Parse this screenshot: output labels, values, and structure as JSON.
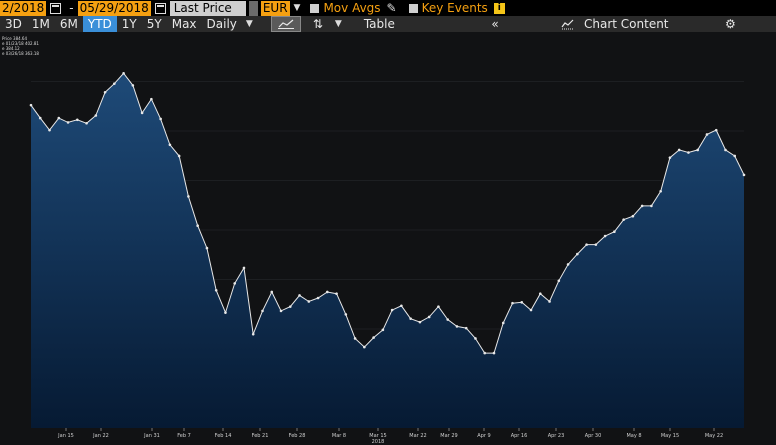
{
  "toolbar": {
    "start_date": "2/2018",
    "date_separator": "-",
    "end_date": "05/29/2018",
    "field": "Last Price",
    "currency": "EUR",
    "mov_avgs_label": "Mov Avgs",
    "key_events_label": "Key Events",
    "info_badge": "i"
  },
  "periods": [
    "3D",
    "1M",
    "6M",
    "YTD",
    "1Y",
    "5Y",
    "Max"
  ],
  "active_period": "YTD",
  "frequency": "Daily",
  "table_label": "Table",
  "back_label": "«",
  "chart_content_label": "Chart Content",
  "icons": {
    "calendar": "calendar-icon",
    "pencil": "pencil-icon",
    "gear": "gear-icon",
    "line_chart": "line-chart-icon",
    "chart_content": "chart-content-icon"
  },
  "colors": {
    "accent_orange": "#f5a011",
    "active_blue": "#3a8fd9",
    "series_line": "#e8e8e8",
    "area_fill_top": "#1e4a78",
    "area_fill_bottom": "#061a33"
  },
  "legend": {
    "line1": "Price   384.64",
    "line2": "e 01/23/18  402.81",
    "line3": "e           384.12",
    "line4": "e 03/26/18  363.18"
  },
  "chart_data": {
    "type": "area",
    "title": "",
    "xlabel": "",
    "ylabel": "",
    "x_tick_labels": [
      "Jan 15",
      "Jan 22",
      "Jan 31",
      "Feb 7",
      "Feb 14",
      "Feb 21",
      "Feb 28",
      "Mar 8",
      "Mar 15",
      "Mar 22",
      "Mar 29",
      "Apr 9",
      "Apr 16",
      "Apr 23",
      "Apr 30",
      "May 8",
      "May 15",
      "May 22"
    ],
    "x_year_label": "2018",
    "grid": true,
    "ylim": [
      359,
      405
    ],
    "series": [
      {
        "values": [
          396.5,
          395.0,
          393.6,
          395.0,
          394.5,
          394.8,
          394.4,
          395.3,
          398.0,
          399.0,
          400.2,
          398.8,
          395.6,
          397.2,
          394.9,
          391.9,
          390.6,
          385.9,
          382.5,
          379.9,
          375.0,
          372.4,
          375.8,
          377.6,
          369.9,
          372.6,
          374.8,
          372.6,
          373.1,
          374.4,
          373.7,
          374.1,
          374.8,
          374.6,
          372.2,
          369.4,
          368.4,
          369.5,
          370.4,
          372.7,
          373.2,
          371.7,
          371.3,
          371.9,
          373.1,
          371.6,
          370.8,
          370.6,
          369.4,
          367.7,
          367.7,
          371.2,
          373.5,
          373.6,
          372.7,
          374.6,
          373.7,
          376.1,
          378.0,
          379.2,
          380.3,
          380.3,
          381.3,
          381.8,
          383.2,
          383.6,
          384.8,
          384.8,
          386.5,
          390.4,
          391.3,
          391.0,
          391.3,
          393.1,
          393.6,
          391.3,
          390.6,
          388.4
        ]
      }
    ]
  }
}
